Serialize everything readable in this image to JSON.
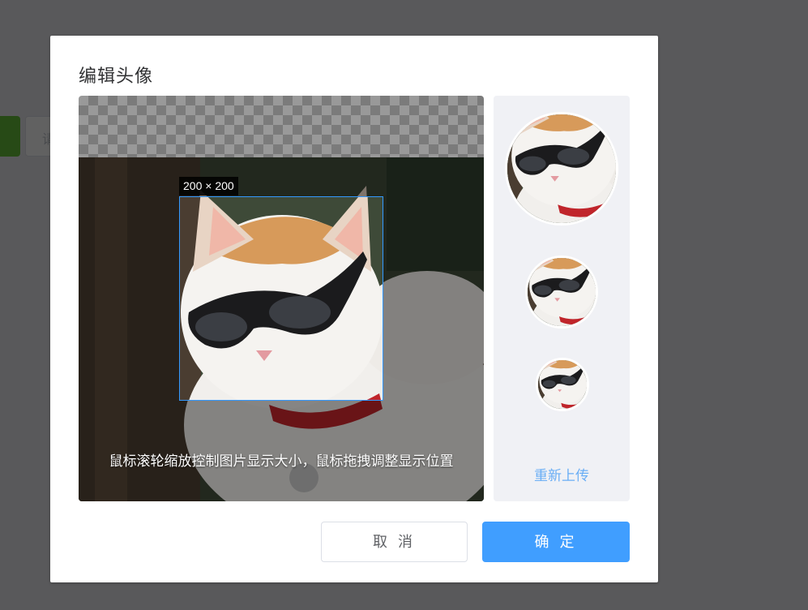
{
  "background_page": {
    "input_placeholder": "请"
  },
  "dialog": {
    "title": "编辑头像",
    "crop_size_label": "200 × 200",
    "hint": "鼠标滚轮缩放控制图片显示大小，鼠标拖拽调整显示位置",
    "reupload_label": "重新上传",
    "cancel_label": "取 消",
    "confirm_label": "确 定"
  },
  "colors": {
    "primary": "#409eff",
    "crop_border": "#3399ff",
    "link": "#6aaef5"
  }
}
